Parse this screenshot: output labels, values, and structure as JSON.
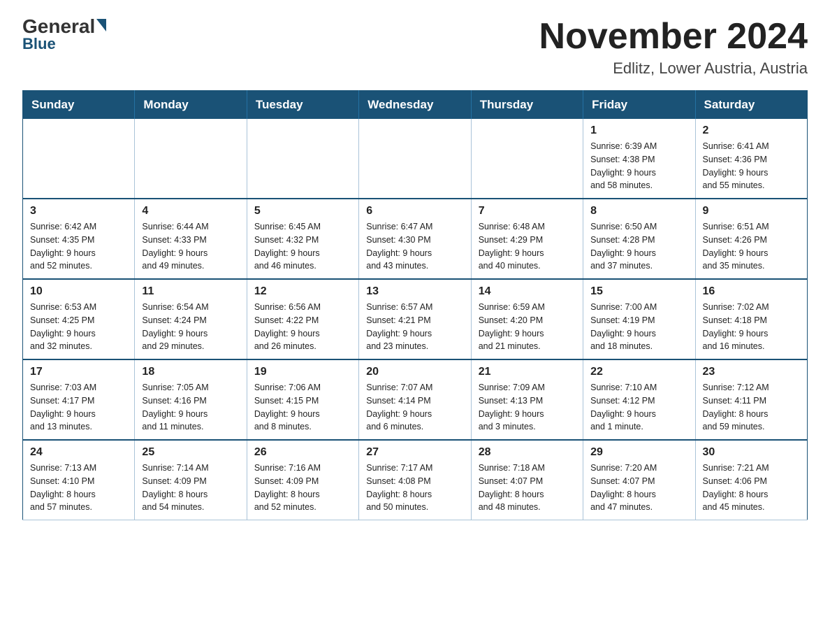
{
  "logo": {
    "top": "General",
    "bottom": "Blue"
  },
  "title": "November 2024",
  "subtitle": "Edlitz, Lower Austria, Austria",
  "weekdays": [
    "Sunday",
    "Monday",
    "Tuesday",
    "Wednesday",
    "Thursday",
    "Friday",
    "Saturday"
  ],
  "weeks": [
    [
      {
        "day": "",
        "info": ""
      },
      {
        "day": "",
        "info": ""
      },
      {
        "day": "",
        "info": ""
      },
      {
        "day": "",
        "info": ""
      },
      {
        "day": "",
        "info": ""
      },
      {
        "day": "1",
        "info": "Sunrise: 6:39 AM\nSunset: 4:38 PM\nDaylight: 9 hours\nand 58 minutes."
      },
      {
        "day": "2",
        "info": "Sunrise: 6:41 AM\nSunset: 4:36 PM\nDaylight: 9 hours\nand 55 minutes."
      }
    ],
    [
      {
        "day": "3",
        "info": "Sunrise: 6:42 AM\nSunset: 4:35 PM\nDaylight: 9 hours\nand 52 minutes."
      },
      {
        "day": "4",
        "info": "Sunrise: 6:44 AM\nSunset: 4:33 PM\nDaylight: 9 hours\nand 49 minutes."
      },
      {
        "day": "5",
        "info": "Sunrise: 6:45 AM\nSunset: 4:32 PM\nDaylight: 9 hours\nand 46 minutes."
      },
      {
        "day": "6",
        "info": "Sunrise: 6:47 AM\nSunset: 4:30 PM\nDaylight: 9 hours\nand 43 minutes."
      },
      {
        "day": "7",
        "info": "Sunrise: 6:48 AM\nSunset: 4:29 PM\nDaylight: 9 hours\nand 40 minutes."
      },
      {
        "day": "8",
        "info": "Sunrise: 6:50 AM\nSunset: 4:28 PM\nDaylight: 9 hours\nand 37 minutes."
      },
      {
        "day": "9",
        "info": "Sunrise: 6:51 AM\nSunset: 4:26 PM\nDaylight: 9 hours\nand 35 minutes."
      }
    ],
    [
      {
        "day": "10",
        "info": "Sunrise: 6:53 AM\nSunset: 4:25 PM\nDaylight: 9 hours\nand 32 minutes."
      },
      {
        "day": "11",
        "info": "Sunrise: 6:54 AM\nSunset: 4:24 PM\nDaylight: 9 hours\nand 29 minutes."
      },
      {
        "day": "12",
        "info": "Sunrise: 6:56 AM\nSunset: 4:22 PM\nDaylight: 9 hours\nand 26 minutes."
      },
      {
        "day": "13",
        "info": "Sunrise: 6:57 AM\nSunset: 4:21 PM\nDaylight: 9 hours\nand 23 minutes."
      },
      {
        "day": "14",
        "info": "Sunrise: 6:59 AM\nSunset: 4:20 PM\nDaylight: 9 hours\nand 21 minutes."
      },
      {
        "day": "15",
        "info": "Sunrise: 7:00 AM\nSunset: 4:19 PM\nDaylight: 9 hours\nand 18 minutes."
      },
      {
        "day": "16",
        "info": "Sunrise: 7:02 AM\nSunset: 4:18 PM\nDaylight: 9 hours\nand 16 minutes."
      }
    ],
    [
      {
        "day": "17",
        "info": "Sunrise: 7:03 AM\nSunset: 4:17 PM\nDaylight: 9 hours\nand 13 minutes."
      },
      {
        "day": "18",
        "info": "Sunrise: 7:05 AM\nSunset: 4:16 PM\nDaylight: 9 hours\nand 11 minutes."
      },
      {
        "day": "19",
        "info": "Sunrise: 7:06 AM\nSunset: 4:15 PM\nDaylight: 9 hours\nand 8 minutes."
      },
      {
        "day": "20",
        "info": "Sunrise: 7:07 AM\nSunset: 4:14 PM\nDaylight: 9 hours\nand 6 minutes."
      },
      {
        "day": "21",
        "info": "Sunrise: 7:09 AM\nSunset: 4:13 PM\nDaylight: 9 hours\nand 3 minutes."
      },
      {
        "day": "22",
        "info": "Sunrise: 7:10 AM\nSunset: 4:12 PM\nDaylight: 9 hours\nand 1 minute."
      },
      {
        "day": "23",
        "info": "Sunrise: 7:12 AM\nSunset: 4:11 PM\nDaylight: 8 hours\nand 59 minutes."
      }
    ],
    [
      {
        "day": "24",
        "info": "Sunrise: 7:13 AM\nSunset: 4:10 PM\nDaylight: 8 hours\nand 57 minutes."
      },
      {
        "day": "25",
        "info": "Sunrise: 7:14 AM\nSunset: 4:09 PM\nDaylight: 8 hours\nand 54 minutes."
      },
      {
        "day": "26",
        "info": "Sunrise: 7:16 AM\nSunset: 4:09 PM\nDaylight: 8 hours\nand 52 minutes."
      },
      {
        "day": "27",
        "info": "Sunrise: 7:17 AM\nSunset: 4:08 PM\nDaylight: 8 hours\nand 50 minutes."
      },
      {
        "day": "28",
        "info": "Sunrise: 7:18 AM\nSunset: 4:07 PM\nDaylight: 8 hours\nand 48 minutes."
      },
      {
        "day": "29",
        "info": "Sunrise: 7:20 AM\nSunset: 4:07 PM\nDaylight: 8 hours\nand 47 minutes."
      },
      {
        "day": "30",
        "info": "Sunrise: 7:21 AM\nSunset: 4:06 PM\nDaylight: 8 hours\nand 45 minutes."
      }
    ]
  ]
}
